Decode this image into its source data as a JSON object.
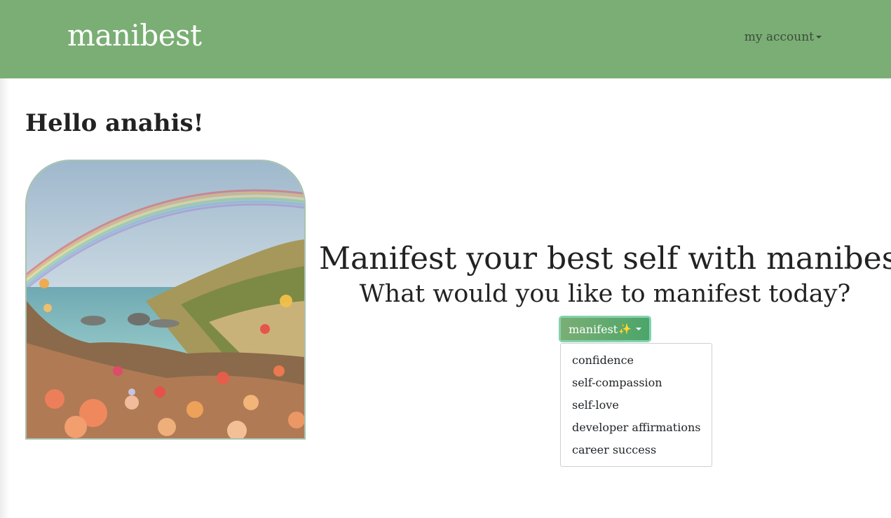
{
  "nav": {
    "brand": "manibest",
    "account_label": "my account"
  },
  "main": {
    "greeting": "Hello anahis!",
    "title": "Manifest your best self with manibest!",
    "subtitle": "What would you like to manifest today?",
    "manifest_button": "manifest",
    "manifest_emoji": "✨",
    "dropdown_items": [
      {
        "label": "confidence"
      },
      {
        "label": "self-compassion"
      },
      {
        "label": "self-love"
      },
      {
        "label": "developer affirmations"
      },
      {
        "label": "career success"
      }
    ]
  },
  "colors": {
    "navbar": "#7aae74",
    "button_start": "#7aae74",
    "button_end": "#4ca56a",
    "button_border": "#86d2b0"
  }
}
